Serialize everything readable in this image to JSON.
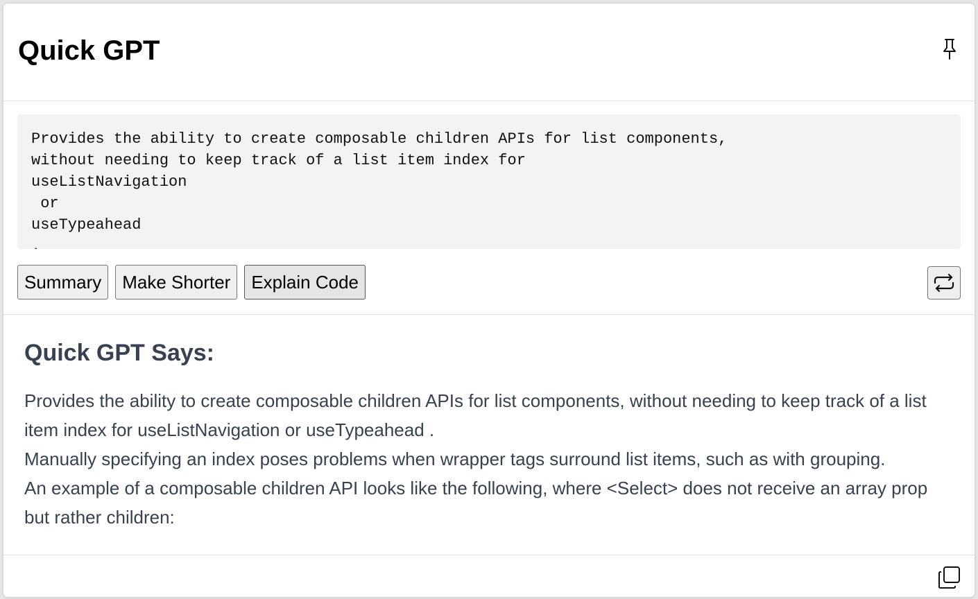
{
  "header": {
    "title": "Quick GPT",
    "pin_icon": "pin-icon"
  },
  "source": {
    "text": "Provides the ability to create composable children APIs for list components,\nwithout needing to keep track of a list item index for\nuseListNavigation\n or\nuseTypeahead\n."
  },
  "actions": {
    "buttons": [
      {
        "label": "Summary"
      },
      {
        "label": "Make Shorter"
      },
      {
        "label": "Explain Code"
      }
    ],
    "regenerate_icon": "repeat-icon"
  },
  "response": {
    "heading": "Quick GPT Says:",
    "paragraphs": [
      "Provides the ability to create composable children APIs for list components, without needing to keep track of a list item index for useListNavigation or useTypeahead .",
      "Manually specifying an index poses problems when wrapper tags surround list items, such as with grouping.",
      "An example of a composable children API looks like the following, where <Select> does not receive an array prop but rather children:"
    ]
  },
  "footer": {
    "copy_icon": "copy-icon"
  },
  "colors": {
    "panel_bg": "#ffffff",
    "source_bg": "#f2f3f5",
    "response_text": "#374151",
    "button_bg": "#efefef"
  }
}
